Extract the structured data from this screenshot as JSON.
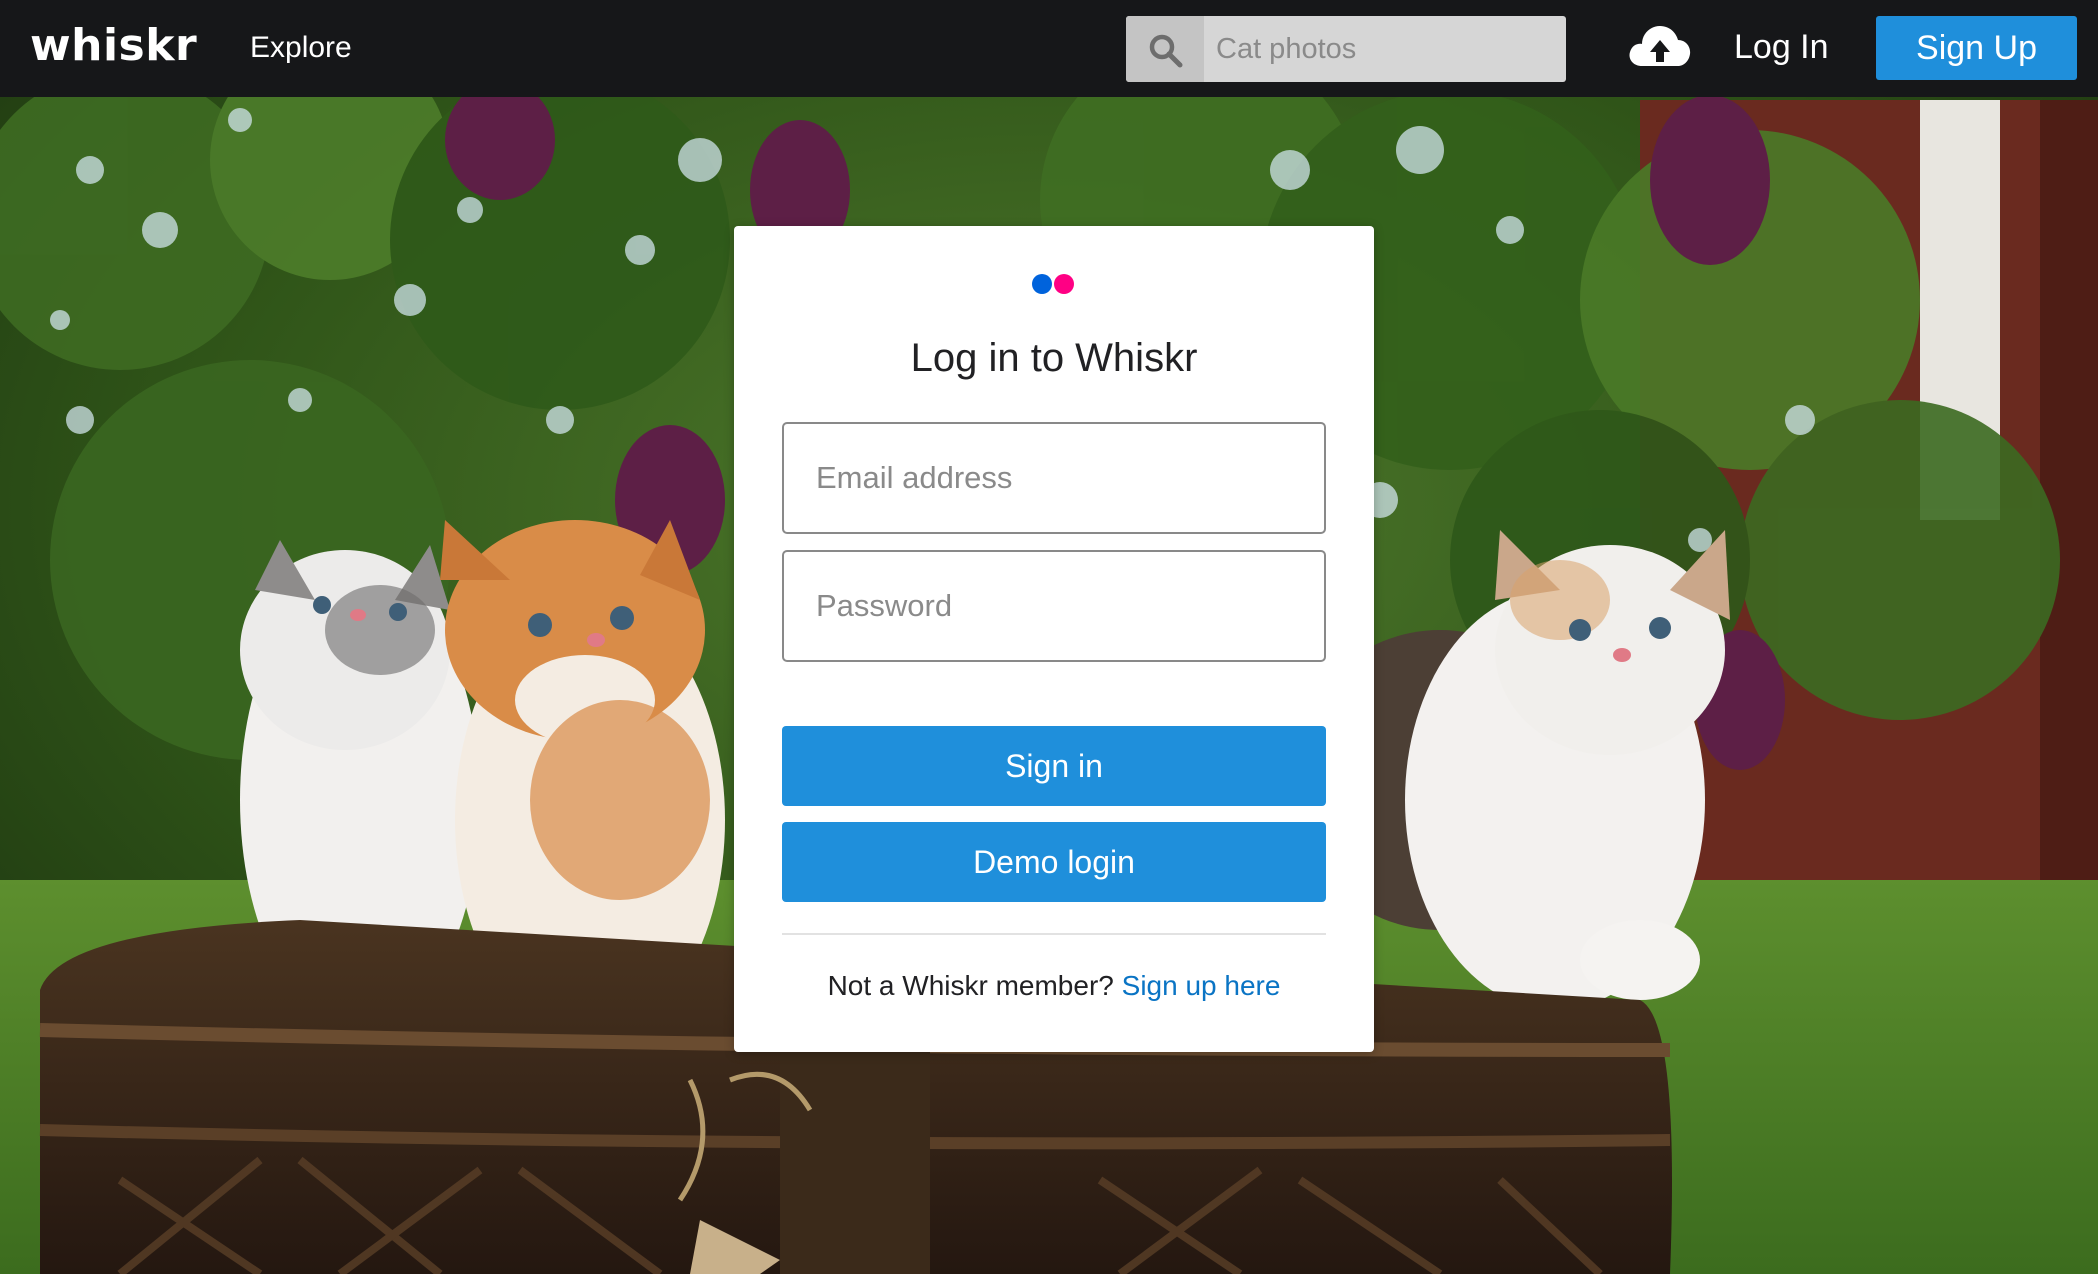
{
  "nav": {
    "logo": "whiskr",
    "explore_label": "Explore",
    "search_placeholder": "Cat photos",
    "login_label": "Log In",
    "signup_label": "Sign Up",
    "upload_icon": "cloud-upload-icon",
    "search_icon": "search-icon"
  },
  "login": {
    "title": "Log in to Whiskr",
    "email_placeholder": "Email address",
    "password_placeholder": "Password",
    "signin_label": "Sign in",
    "demo_label": "Demo login",
    "member_prompt": "Not a Whiskr member? ",
    "signup_link": "Sign up here"
  },
  "colors": {
    "nav_bg": "#161719",
    "accent_blue": "#1f8fdb",
    "brand_dot_blue": "#0063dc",
    "brand_dot_pink": "#ff0084",
    "link": "#0a74c4"
  }
}
